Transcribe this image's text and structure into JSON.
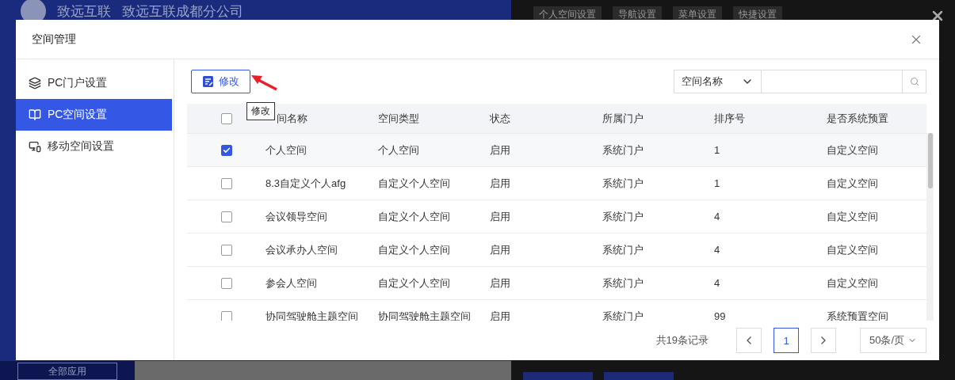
{
  "background": {
    "brand": "致远互联",
    "company": "致远互联成都分公司",
    "panel_tabs": [
      "个人空间设置",
      "导航设置",
      "菜单设置",
      "快捷设置"
    ],
    "all_apps_button": "全部应用"
  },
  "dialog": {
    "title": "空间管理"
  },
  "sidebar": {
    "items": [
      {
        "label": "PC门户设置",
        "selected": false,
        "kind": "layers"
      },
      {
        "label": "PC空间设置",
        "selected": true,
        "kind": "book"
      },
      {
        "label": "移动空间设置",
        "selected": false,
        "kind": "mobile"
      }
    ]
  },
  "toolbar": {
    "edit_button": "修改",
    "tooltip": "修改"
  },
  "search": {
    "field_select": "空间名称"
  },
  "table": {
    "columns": [
      "间名称",
      "空间类型",
      "状态",
      "所属门户",
      "排序号",
      "是否系统预置"
    ],
    "header_checked": false,
    "rows": [
      {
        "checked": true,
        "cells": [
          "个人空间",
          "个人空间",
          "启用",
          "系统门户",
          "1",
          "自定义空间"
        ]
      },
      {
        "checked": false,
        "cells": [
          "8.3自定义个人afg",
          "自定义个人空间",
          "启用",
          "系统门户",
          "1",
          "自定义空间"
        ]
      },
      {
        "checked": false,
        "cells": [
          "会议领导空间",
          "自定义个人空间",
          "启用",
          "系统门户",
          "4",
          "自定义空间"
        ]
      },
      {
        "checked": false,
        "cells": [
          "会议承办人空间",
          "自定义个人空间",
          "启用",
          "系统门户",
          "4",
          "自定义空间"
        ]
      },
      {
        "checked": false,
        "cells": [
          "参会人空间",
          "自定义个人空间",
          "启用",
          "系统门户",
          "4",
          "自定义空间"
        ]
      },
      {
        "checked": false,
        "cells": [
          "协同驾驶舱主题空间",
          "协同驾驶舱主题空间",
          "启用",
          "系统门户",
          "99",
          "系统预置空间"
        ]
      }
    ]
  },
  "pagination": {
    "summary": "共19条记录",
    "pages": [
      {
        "label": "1",
        "selected": true
      }
    ],
    "page_size": "50条/页"
  }
}
